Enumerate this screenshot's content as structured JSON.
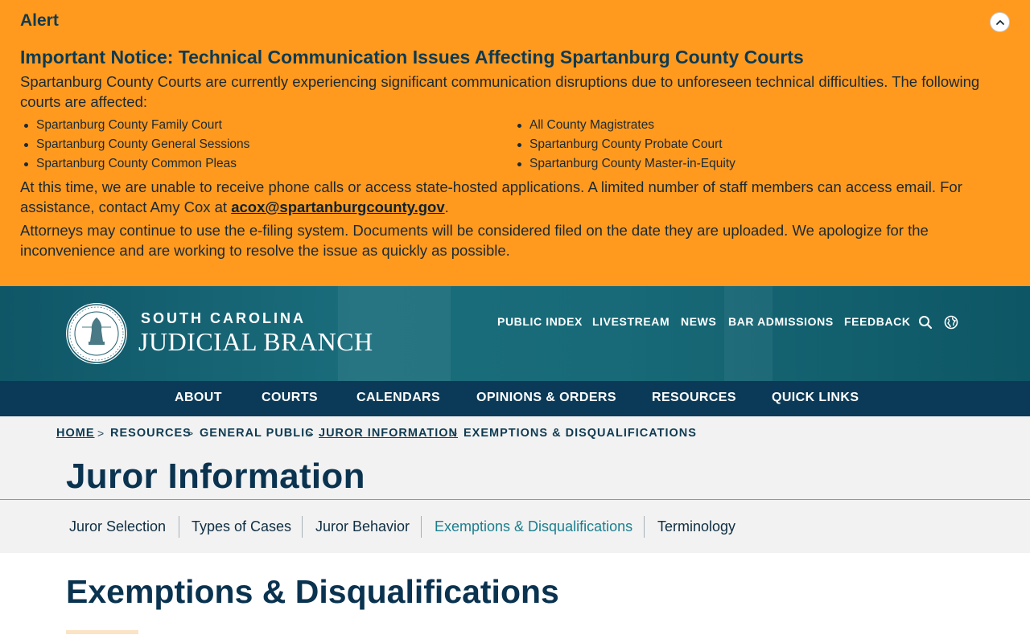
{
  "alert": {
    "label": "Alert",
    "heading": "Important Notice: Technical Communication Issues Affecting Spartanburg County Courts",
    "intro": "Spartanburg County Courts are currently experiencing significant communication disruptions due to unforeseen technical difficulties. The following courts are affected:",
    "courts_left": [
      "Spartanburg County Family Court",
      "Spartanburg County General Sessions",
      "Spartanburg County Common Pleas"
    ],
    "courts_right": [
      "All County Magistrates",
      "Spartanburg County Probate Court",
      "Spartanburg County Master-in-Equity"
    ],
    "contact_text": "At this time, we are unable to receive phone calls or access state-hosted applications. A limited number of staff members can access email. For assistance, contact Amy Cox at",
    "contact_email": "acox@spartanburgcounty.gov",
    "contact_end": ".",
    "efiling_text": "Attorneys may continue to use the e-filing system. Documents will be considered filed on the date they are uploaded. We apologize for the inconvenience and are working to resolve the issue as quickly as possible.",
    "toggle_icon": "chevron-up-icon",
    "background_color": "#ff9a1f"
  },
  "header": {
    "brand_top": "SOUTH CAROLINA",
    "brand_main": "JUDICIAL BRANCH",
    "seal_text_top": "SUPREME COURT OF SOUTH CAROLINA",
    "seal_text_bottom": "NIL ULTRA",
    "utility_nav": [
      "PUBLIC INDEX",
      "LIVESTREAM",
      "NEWS",
      "BAR ADMISSIONS",
      "FEEDBACK"
    ],
    "search_icon": "search-icon",
    "globe_icon": "globe-icon"
  },
  "main_nav": [
    "ABOUT",
    "COURTS",
    "CALENDARS",
    "OPINIONS & ORDERS",
    "RESOURCES",
    "QUICK LINKS"
  ],
  "breadcrumb": [
    "HOME",
    "RESOURCES",
    "GENERAL PUBLIC",
    "JUROR INFORMATION",
    "EXEMPTIONS & DISQUALIFICATIONS"
  ],
  "breadcrumb_separator": ">",
  "page_title": "Juror Information",
  "sub_nav": {
    "items": [
      "Juror Selection",
      "Types of Cases",
      "Juror Behavior",
      "Exemptions & Disqualifications",
      "Terminology"
    ],
    "active": "Exemptions & Disqualifications"
  },
  "content": {
    "title": "Exemptions & Disqualifications"
  },
  "colors": {
    "alert_bg": "#ff9a1f",
    "header_bg": "#135f6f",
    "nav_bg": "#0a3a57",
    "title_color": "#0a3350",
    "active_link": "#1a7f8e"
  }
}
